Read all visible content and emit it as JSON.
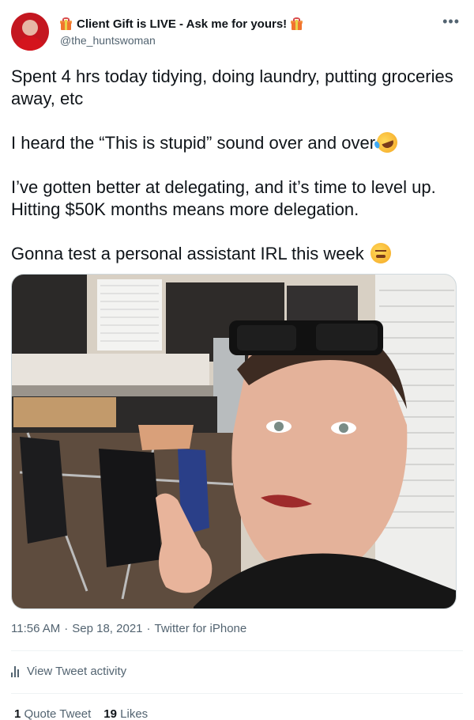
{
  "user": {
    "display_name": "Client Gift is LIVE - Ask me for yours!",
    "handle": "@the_huntswoman",
    "left_icon": "gift-icon",
    "right_icon": "gift-icon"
  },
  "more_label": "•••",
  "tweet": {
    "paragraphs": [
      {
        "text": "Spent 4 hrs today tidying, doing laundry, putting groceries away, etc"
      },
      {
        "text": "I heard the “This is stupid” sound over and over",
        "emoji": "rolling-on-floor-laughing-icon"
      },
      {
        "text": "I’ve gotten better at delegating, and it’s time to level up. Hitting $50K months means more delegation."
      },
      {
        "text": "Gonna test a personal assistant IRL this week",
        "emoji": "face-with-steam-icon"
      }
    ]
  },
  "meta": {
    "time": "11:56 AM",
    "date": "Sep 18, 2021",
    "source": "Twitter for iPhone",
    "separator": "·"
  },
  "activity": {
    "label": "View Tweet activity",
    "icon": "analytics-bars-icon"
  },
  "stats": {
    "quote_count": "1",
    "quote_label": "Quote Tweet",
    "likes_count": "19",
    "likes_label": "Likes"
  },
  "colors": {
    "text_primary": "#0f1419",
    "text_secondary": "#536471",
    "border": "#cfd9de",
    "divider": "#eff3f4",
    "avatar_red": "#d4141d"
  }
}
